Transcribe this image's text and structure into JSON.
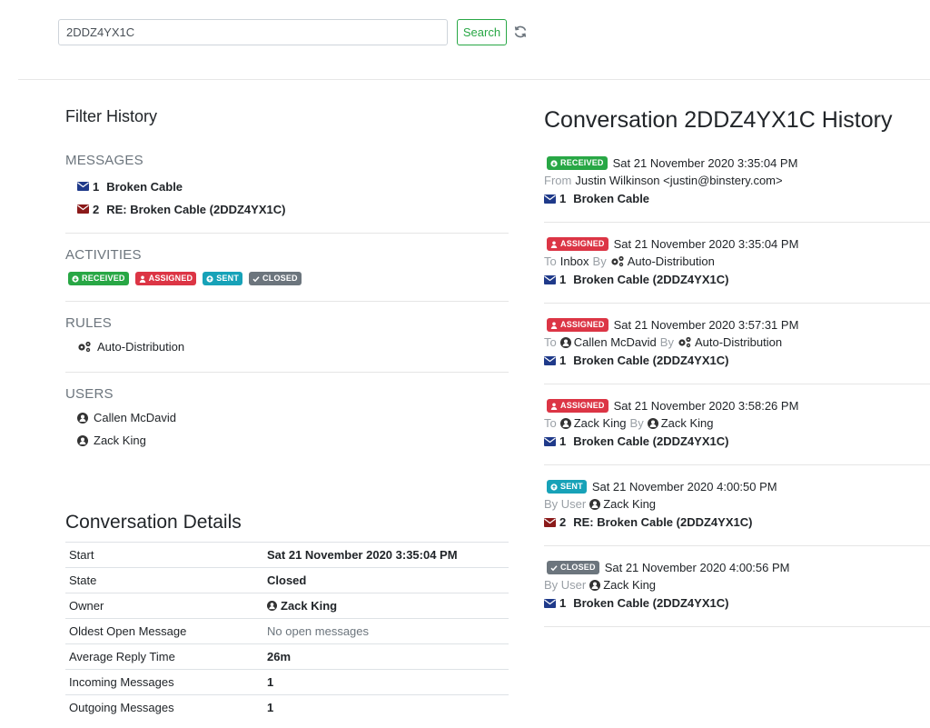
{
  "search": {
    "value": "2DDZ4YX1C",
    "button_label": "Search"
  },
  "filter": {
    "title": "Filter History",
    "messages_title": "MESSAGES",
    "messages": [
      {
        "number": "1",
        "subject": "Broken Cable",
        "color": "#1f3a8a"
      },
      {
        "number": "2",
        "subject": "RE: Broken Cable (2DDZ4YX1C)",
        "color": "#8b1a1a"
      }
    ],
    "activities_title": "ACTIVITIES",
    "activities": [
      "RECEIVED",
      "ASSIGNED",
      "SENT",
      "CLOSED"
    ],
    "rules_title": "RULES",
    "rules": [
      "Auto-Distribution"
    ],
    "users_title": "USERS",
    "users": [
      "Callen McDavid",
      "Zack King"
    ]
  },
  "details": {
    "title": "Conversation Details",
    "rows": [
      {
        "key": "Start",
        "value": "Sat 21 November 2020 3:35:04 PM"
      },
      {
        "key": "State",
        "value": "Closed"
      },
      {
        "key": "Owner",
        "value": "Zack King"
      },
      {
        "key": "Oldest Open Message",
        "value": "No open messages"
      },
      {
        "key": "Average Reply Time",
        "value": "26m"
      },
      {
        "key": "Incoming Messages",
        "value": "1"
      },
      {
        "key": "Outgoing Messages",
        "value": "1"
      }
    ]
  },
  "history": {
    "title": "Conversation 2DDZ4YX1C History",
    "events": [
      {
        "badge": "RECEIVED",
        "time": "Sat 21 November 2020 3:35:04 PM",
        "l1": "From",
        "v1": "Justin Wilkinson <justin@binstery.com>",
        "l2": "",
        "v2": "",
        "msg_num": "1",
        "msg_subject": "Broken Cable"
      },
      {
        "badge": "ASSIGNED",
        "time": "Sat 21 November 2020 3:35:04 PM",
        "l1": "To",
        "v1": "Inbox",
        "l2": "By",
        "v2": "Auto-Distribution",
        "msg_num": "1",
        "msg_subject": "Broken Cable (2DDZ4YX1C)"
      },
      {
        "badge": "ASSIGNED",
        "time": "Sat 21 November 2020 3:57:31 PM",
        "l1": "To",
        "v1": "Callen McDavid",
        "l2": "By",
        "v2": "Auto-Distribution",
        "msg_num": "1",
        "msg_subject": "Broken Cable (2DDZ4YX1C)"
      },
      {
        "badge": "ASSIGNED",
        "time": "Sat 21 November 2020 3:58:26 PM",
        "l1": "To",
        "v1": "Zack King",
        "l2": "By",
        "v2": "Zack King",
        "msg_num": "1",
        "msg_subject": "Broken Cable (2DDZ4YX1C)"
      },
      {
        "badge": "SENT",
        "time": "Sat 21 November 2020 4:00:50 PM",
        "l1": "By User",
        "v1": "Zack King",
        "l2": "",
        "v2": "",
        "msg_num": "2",
        "msg_subject": "RE: Broken Cable (2DDZ4YX1C)"
      },
      {
        "badge": "CLOSED",
        "time": "Sat 21 November 2020 4:00:56 PM",
        "l1": "By User",
        "v1": "Zack King",
        "l2": "",
        "v2": "",
        "msg_num": "1",
        "msg_subject": "Broken Cable (2DDZ4YX1C)"
      }
    ]
  },
  "colors": {
    "received": "#28a745",
    "assigned": "#dc3545",
    "sent": "#17a2b8",
    "closed": "#6c757d",
    "envelope_blue": "#1f3a8a",
    "envelope_red": "#8b1a1a"
  }
}
